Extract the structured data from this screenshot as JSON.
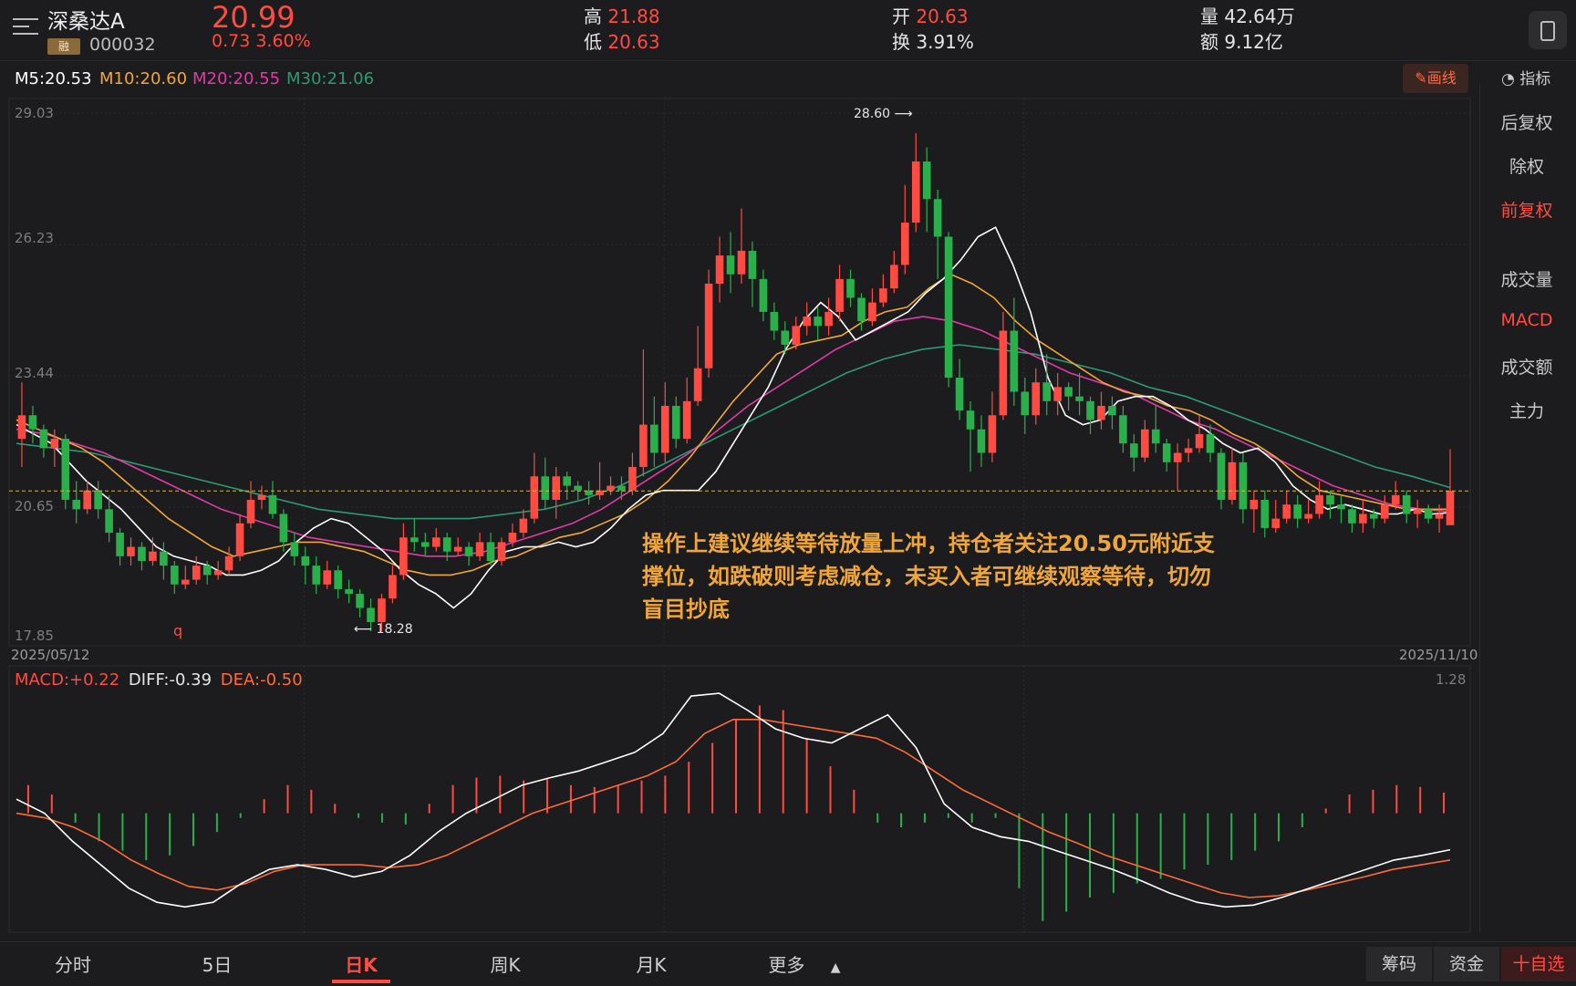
{
  "header": {
    "stock_name": "深桑达A",
    "badge": "融",
    "stock_code": "000032",
    "price": "20.99",
    "change": "0.73  3.60%",
    "high_label": "高",
    "high_value": "21.88",
    "low_label": "低",
    "low_value": "20.63",
    "open_label": "开",
    "open_value": "20.63",
    "turnover_label": "换",
    "turnover_value": "3.91%",
    "volume_label": "量",
    "volume_value": "42.64万",
    "amount_label": "额",
    "amount_value": "9.12亿"
  },
  "ma_legend": {
    "m5": "M5:20.53",
    "m10": "M10:20.60",
    "m20": "M20:20.55",
    "m30": "M30:21.06"
  },
  "toolbar": {
    "draw_label": "✎画线",
    "indicator_label": "指标"
  },
  "side_panel": {
    "items": [
      "后复权",
      "除权",
      "前复权",
      "成交量",
      "MACD",
      "成交额",
      "主力"
    ]
  },
  "price_axis": {
    "labels": [
      "29.03",
      "26.23",
      "23.44",
      "20.65",
      "17.85"
    ],
    "start_date": "2025/05/12",
    "end_date": "2025/11/10",
    "high_marker": "28.60",
    "low_marker": "18.28",
    "q_marker": "q"
  },
  "macd_legend": {
    "macd": "MACD:+0.22",
    "diff": "DIFF:-0.39",
    "dea": "DEA:-0.50",
    "scale_top": "1.28"
  },
  "annotation": {
    "text": "操作上建议继续等待放量上冲，持仓者关注20.50元附近支撑位，如跌破则考虑减仓，未买入者可继续观察等待，切勿盲目抄底"
  },
  "bottom_nav": {
    "tabs": [
      "分时",
      "5日",
      "日K",
      "周K",
      "月K",
      "更多"
    ],
    "chips_label": "筹码",
    "funds_label": "资金",
    "watch_label": "十自选"
  },
  "colors": {
    "up": "#ff4b42",
    "down": "#2ab04a",
    "m5": "#ffffff",
    "m10": "#f0a63a",
    "m20": "#e03aa8",
    "m30": "#2e9a72",
    "background": "#1c1c1e"
  },
  "chart_data": {
    "type": "candlestick",
    "x_start": "2025/05/12",
    "x_end": "2025/11/10",
    "ylim": [
      17.85,
      29.03
    ],
    "last_close_line": 20.99,
    "ohlc": [
      [
        22.1,
        22.6,
        23.3,
        21.5
      ],
      [
        22.6,
        22.3,
        22.8,
        22.0
      ],
      [
        22.3,
        21.9,
        22.4,
        21.7
      ],
      [
        21.9,
        22.1,
        22.3,
        21.5
      ],
      [
        22.1,
        20.8,
        22.2,
        20.6
      ],
      [
        20.8,
        20.6,
        21.2,
        20.3
      ],
      [
        20.6,
        21.0,
        21.2,
        20.5
      ],
      [
        21.0,
        20.6,
        21.2,
        20.4
      ],
      [
        20.6,
        20.1,
        20.9,
        19.9
      ],
      [
        20.1,
        19.6,
        20.2,
        19.4
      ],
      [
        19.6,
        19.8,
        20.0,
        19.4
      ],
      [
        19.8,
        19.5,
        19.9,
        19.3
      ],
      [
        19.5,
        19.7,
        20.0,
        19.4
      ],
      [
        19.7,
        19.4,
        19.9,
        19.1
      ],
      [
        19.4,
        19.0,
        19.5,
        18.8
      ],
      [
        19.0,
        19.1,
        19.4,
        18.9
      ],
      [
        19.1,
        19.4,
        19.6,
        19.0
      ],
      [
        19.4,
        19.2,
        19.5,
        19.0
      ],
      [
        19.2,
        19.3,
        19.5,
        19.1
      ],
      [
        19.3,
        19.6,
        19.8,
        19.2
      ],
      [
        19.6,
        20.3,
        20.5,
        19.5
      ],
      [
        20.3,
        20.8,
        21.2,
        20.2
      ],
      [
        20.8,
        20.9,
        21.1,
        20.6
      ],
      [
        20.9,
        20.5,
        21.2,
        20.4
      ],
      [
        20.5,
        19.9,
        20.6,
        19.7
      ],
      [
        19.9,
        19.6,
        20.1,
        19.4
      ],
      [
        19.6,
        19.4,
        19.8,
        19.0
      ],
      [
        19.4,
        19.0,
        19.6,
        18.8
      ],
      [
        19.0,
        19.3,
        19.5,
        18.9
      ],
      [
        19.3,
        18.9,
        19.4,
        18.7
      ],
      [
        18.9,
        18.8,
        19.1,
        18.6
      ],
      [
        18.8,
        18.5,
        18.9,
        18.3
      ],
      [
        18.5,
        18.2,
        18.7,
        18.0
      ],
      [
        18.2,
        18.7,
        18.8,
        18.0
      ],
      [
        18.7,
        19.2,
        19.4,
        18.6
      ],
      [
        19.2,
        20.0,
        20.3,
        19.1
      ],
      [
        20.0,
        19.9,
        20.4,
        19.7
      ],
      [
        19.9,
        19.8,
        20.1,
        19.6
      ],
      [
        19.8,
        20.0,
        20.2,
        19.7
      ],
      [
        20.0,
        19.7,
        20.1,
        19.5
      ],
      [
        19.7,
        19.8,
        20.0,
        19.6
      ],
      [
        19.8,
        19.6,
        19.9,
        19.4
      ],
      [
        19.6,
        19.9,
        20.1,
        19.5
      ],
      [
        19.9,
        19.5,
        20.1,
        19.4
      ],
      [
        19.5,
        19.9,
        20.0,
        19.4
      ],
      [
        19.9,
        20.1,
        20.3,
        19.8
      ],
      [
        20.1,
        20.4,
        20.6,
        20.0
      ],
      [
        20.4,
        21.3,
        21.8,
        20.3
      ],
      [
        21.3,
        20.8,
        21.7,
        20.6
      ],
      [
        20.8,
        21.3,
        21.5,
        20.4
      ],
      [
        21.3,
        21.1,
        21.4,
        20.8
      ],
      [
        21.1,
        21.0,
        21.2,
        20.8
      ],
      [
        21.0,
        20.9,
        21.2,
        20.7
      ],
      [
        20.9,
        21.0,
        21.6,
        20.8
      ],
      [
        21.0,
        21.1,
        21.3,
        20.9
      ],
      [
        21.1,
        21.0,
        21.3,
        20.8
      ],
      [
        21.0,
        21.5,
        21.8,
        20.9
      ],
      [
        21.5,
        22.4,
        24.0,
        21.3
      ],
      [
        22.4,
        21.8,
        23.0,
        21.5
      ],
      [
        21.8,
        22.8,
        23.3,
        21.6
      ],
      [
        22.8,
        22.1,
        23.0,
        21.9
      ],
      [
        22.1,
        22.9,
        23.4,
        22.0
      ],
      [
        22.9,
        23.6,
        24.5,
        22.8
      ],
      [
        23.6,
        25.4,
        25.7,
        23.4
      ],
      [
        25.4,
        26.0,
        26.4,
        25.0
      ],
      [
        26.0,
        25.6,
        26.5,
        25.2
      ],
      [
        25.6,
        26.1,
        27.0,
        25.4
      ],
      [
        26.1,
        25.5,
        26.3,
        24.9
      ],
      [
        25.5,
        24.8,
        25.7,
        24.6
      ],
      [
        24.8,
        24.4,
        25.0,
        24.2
      ],
      [
        24.4,
        24.1,
        24.6,
        23.9
      ],
      [
        24.1,
        24.5,
        24.7,
        24.0
      ],
      [
        24.5,
        24.7,
        25.0,
        24.3
      ],
      [
        24.7,
        24.5,
        24.9,
        24.2
      ],
      [
        24.5,
        24.8,
        25.1,
        24.3
      ],
      [
        24.8,
        25.5,
        25.8,
        24.6
      ],
      [
        25.5,
        25.1,
        25.7,
        24.9
      ],
      [
        25.1,
        24.6,
        25.2,
        24.4
      ],
      [
        24.6,
        25.0,
        25.3,
        24.5
      ],
      [
        25.0,
        25.3,
        25.6,
        24.9
      ],
      [
        25.3,
        25.8,
        26.1,
        25.2
      ],
      [
        25.8,
        26.7,
        27.5,
        25.6
      ],
      [
        26.7,
        28.0,
        28.6,
        26.5
      ],
      [
        28.0,
        27.2,
        28.3,
        26.5
      ],
      [
        27.2,
        26.4,
        27.4,
        25.5
      ],
      [
        26.4,
        23.4,
        26.5,
        23.2
      ],
      [
        23.4,
        22.7,
        23.8,
        22.5
      ],
      [
        22.7,
        22.3,
        22.9,
        21.4
      ],
      [
        22.3,
        21.8,
        22.6,
        21.5
      ],
      [
        21.8,
        22.6,
        23.1,
        21.6
      ],
      [
        22.6,
        24.4,
        24.8,
        22.5
      ],
      [
        24.4,
        23.1,
        25.1,
        22.8
      ],
      [
        23.1,
        22.6,
        23.4,
        22.2
      ],
      [
        22.6,
        23.3,
        23.6,
        22.4
      ],
      [
        23.3,
        22.9,
        23.9,
        22.6
      ],
      [
        22.9,
        23.2,
        23.5,
        22.6
      ],
      [
        23.2,
        23.0,
        23.3,
        22.7
      ],
      [
        23.0,
        22.9,
        23.5,
        22.6
      ],
      [
        22.9,
        22.5,
        23.0,
        22.2
      ],
      [
        22.5,
        22.8,
        23.1,
        22.3
      ],
      [
        22.8,
        22.6,
        23.0,
        22.3
      ],
      [
        22.6,
        22.0,
        22.8,
        21.8
      ],
      [
        22.0,
        21.7,
        22.2,
        21.4
      ],
      [
        21.7,
        22.3,
        22.5,
        21.6
      ],
      [
        22.3,
        22.0,
        22.8,
        21.8
      ],
      [
        22.0,
        21.6,
        22.1,
        21.4
      ],
      [
        21.6,
        21.8,
        22.0,
        21.0
      ],
      [
        21.8,
        21.9,
        22.1,
        21.6
      ],
      [
        21.9,
        22.2,
        22.6,
        21.8
      ],
      [
        22.2,
        21.8,
        22.4,
        21.6
      ],
      [
        21.8,
        20.8,
        21.9,
        20.6
      ],
      [
        20.8,
        21.6,
        21.9,
        20.7
      ],
      [
        21.6,
        20.6,
        21.8,
        20.3
      ],
      [
        20.6,
        20.8,
        21.0,
        20.1
      ],
      [
        20.8,
        20.2,
        21.0,
        20.0
      ],
      [
        20.2,
        20.4,
        20.8,
        20.1
      ],
      [
        20.4,
        20.7,
        21.0,
        20.3
      ],
      [
        20.7,
        20.4,
        20.9,
        20.2
      ],
      [
        20.4,
        20.5,
        20.8,
        20.3
      ],
      [
        20.5,
        20.9,
        21.2,
        20.4
      ],
      [
        20.9,
        20.7,
        21.0,
        20.4
      ],
      [
        20.7,
        20.6,
        20.9,
        20.3
      ],
      [
        20.6,
        20.3,
        20.7,
        20.1
      ],
      [
        20.3,
        20.5,
        20.8,
        20.1
      ],
      [
        20.5,
        20.4,
        20.6,
        20.2
      ],
      [
        20.4,
        20.7,
        20.9,
        20.3
      ],
      [
        20.7,
        20.9,
        21.2,
        20.6
      ],
      [
        20.9,
        20.5,
        21.0,
        20.3
      ],
      [
        20.5,
        20.6,
        20.8,
        20.2
      ],
      [
        20.6,
        20.4,
        20.7,
        20.3
      ],
      [
        20.4,
        20.5,
        20.7,
        20.1
      ],
      [
        20.26,
        20.99,
        21.88,
        20.63
      ]
    ],
    "ma5": [
      22.4,
      22.2,
      22.0,
      21.6,
      21.2,
      20.9,
      20.6,
      20.2,
      19.8,
      19.6,
      19.5,
      19.4,
      19.2,
      19.2,
      19.3,
      19.5,
      19.9,
      20.2,
      20.4,
      20.3,
      20.0,
      19.7,
      19.3,
      19.0,
      18.8,
      18.5,
      18.8,
      19.3,
      19.7,
      19.8,
      19.8,
      19.9,
      19.8,
      19.9,
      20.2,
      20.6,
      20.9,
      21.0,
      21.0,
      21.0,
      21.4,
      22.0,
      22.6,
      23.2,
      24.0,
      24.6,
      25.0,
      24.7,
      24.2,
      24.4,
      24.6,
      24.8,
      25.2,
      25.5,
      25.9,
      26.4,
      26.6,
      25.8,
      24.8,
      23.4,
      22.6,
      22.4,
      22.5,
      22.9,
      23.0,
      23.0,
      22.8,
      22.5,
      22.3,
      22.0,
      21.8,
      21.9,
      21.6,
      21.1,
      20.8,
      20.6,
      20.7,
      20.6,
      20.5,
      20.5,
      20.6,
      20.5,
      20.53
    ],
    "ma10": [
      22.5,
      22.3,
      22.1,
      21.9,
      21.6,
      21.2,
      20.8,
      20.4,
      20.1,
      19.8,
      19.6,
      19.7,
      19.8,
      19.9,
      19.9,
      19.8,
      19.7,
      19.5,
      19.3,
      19.2,
      19.2,
      19.3,
      19.5,
      19.6,
      19.8,
      20.0,
      20.1,
      20.3,
      20.5,
      20.8,
      21.2,
      21.7,
      22.3,
      22.9,
      23.4,
      23.9,
      24.1,
      24.2,
      24.3,
      24.6,
      24.8,
      24.9,
      25.3,
      25.6,
      25.4,
      25.1,
      24.6,
      24.2,
      23.9,
      23.6,
      23.3,
      23.1,
      23.0,
      22.8,
      22.7,
      22.5,
      22.2,
      22.0,
      21.7,
      21.3,
      21.0,
      20.9,
      20.8,
      20.7,
      20.6,
      20.6,
      20.6
    ],
    "ma20": [
      22.3,
      22.2,
      22.0,
      21.8,
      21.5,
      21.2,
      20.9,
      20.6,
      20.4,
      20.2,
      20.0,
      19.9,
      19.8,
      19.7,
      19.6,
      19.6,
      19.7,
      19.9,
      20.1,
      20.3,
      20.6,
      21.0,
      21.4,
      21.8,
      22.3,
      22.8,
      23.2,
      23.6,
      24.0,
      24.3,
      24.6,
      24.7,
      24.6,
      24.4,
      24.1,
      23.8,
      23.5,
      23.3,
      23.1,
      22.8,
      22.5,
      22.3,
      22.0,
      21.7,
      21.4,
      21.1,
      20.9,
      20.7,
      20.6,
      20.55
    ],
    "ma30": [
      22.0,
      21.9,
      21.8,
      21.6,
      21.4,
      21.2,
      21.0,
      20.8,
      20.6,
      20.5,
      20.4,
      20.4,
      20.4,
      20.5,
      20.6,
      20.8,
      21.1,
      21.5,
      21.9,
      22.3,
      22.7,
      23.1,
      23.5,
      23.8,
      24.0,
      24.1,
      24.0,
      23.9,
      23.7,
      23.5,
      23.2,
      23.0,
      22.7,
      22.4,
      22.1,
      21.8,
      21.5,
      21.3,
      21.06
    ],
    "macd_hist": [
      0.3,
      0.2,
      -0.1,
      -0.3,
      -0.4,
      -0.5,
      -0.45,
      -0.35,
      -0.2,
      -0.05,
      0.15,
      0.3,
      0.25,
      0.1,
      -0.05,
      -0.1,
      -0.12,
      0.1,
      0.3,
      0.38,
      0.4,
      0.35,
      0.38,
      0.3,
      0.28,
      0.3,
      0.35,
      0.4,
      0.55,
      0.75,
      1.0,
      1.15,
      1.1,
      0.8,
      0.5,
      0.25,
      -0.1,
      -0.15,
      -0.1,
      -0.05,
      -0.1,
      -0.05,
      -0.8,
      -1.15,
      -1.05,
      -0.9,
      -0.85,
      -0.75,
      -0.7,
      -0.6,
      -0.55,
      -0.5,
      -0.4,
      -0.3,
      -0.15,
      0.05,
      0.2,
      0.25,
      0.3,
      0.28,
      0.22
    ],
    "diff": [
      0.15,
      0.0,
      -0.3,
      -0.55,
      -0.8,
      -0.95,
      -1.0,
      -0.95,
      -0.75,
      -0.6,
      -0.55,
      -0.6,
      -0.68,
      -0.62,
      -0.45,
      -0.2,
      0.0,
      0.15,
      0.3,
      0.38,
      0.45,
      0.55,
      0.65,
      0.85,
      1.25,
      1.28,
      1.1,
      0.9,
      0.8,
      0.75,
      0.9,
      1.05,
      0.7,
      0.1,
      -0.15,
      -0.25,
      -0.3,
      -0.4,
      -0.5,
      -0.6,
      -0.72,
      -0.85,
      -0.95,
      -1.0,
      -0.98,
      -0.9,
      -0.8,
      -0.7,
      -0.6,
      -0.5,
      -0.45,
      -0.39
    ],
    "dea": [
      0.0,
      -0.05,
      -0.15,
      -0.3,
      -0.5,
      -0.65,
      -0.78,
      -0.82,
      -0.75,
      -0.62,
      -0.55,
      -0.55,
      -0.55,
      -0.58,
      -0.55,
      -0.45,
      -0.3,
      -0.15,
      0.0,
      0.1,
      0.2,
      0.3,
      0.4,
      0.55,
      0.85,
      1.0,
      1.0,
      0.95,
      0.9,
      0.85,
      0.8,
      0.65,
      0.45,
      0.25,
      0.1,
      -0.05,
      -0.2,
      -0.32,
      -0.45,
      -0.55,
      -0.65,
      -0.75,
      -0.85,
      -0.9,
      -0.88,
      -0.82,
      -0.75,
      -0.68,
      -0.6,
      -0.55,
      -0.5
    ]
  }
}
